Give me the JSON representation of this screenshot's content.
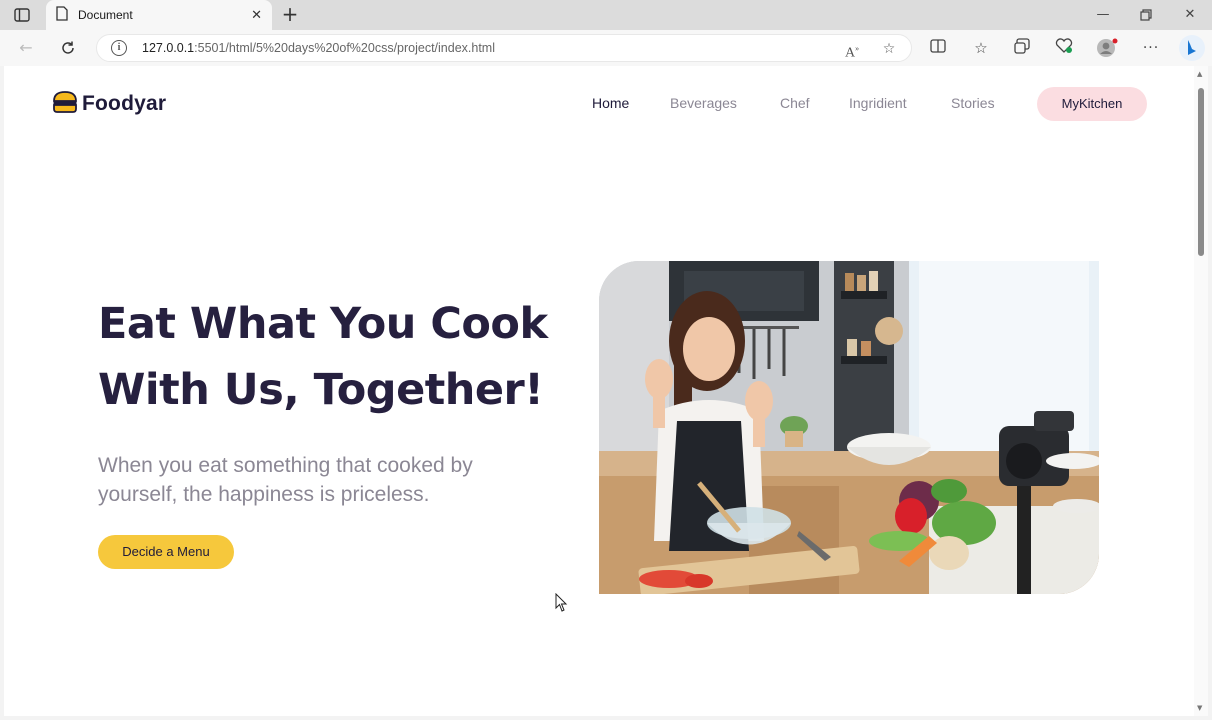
{
  "browser": {
    "tab_title": "Document",
    "url_host": "127.0.0.1",
    "url_rest": ":5501/html/5%20days%20of%20css/project/index.html",
    "icons": [
      "sidebar-icon",
      "page-icon",
      "close-icon",
      "plus-icon",
      "back-icon",
      "refresh-icon",
      "info-icon",
      "read-aloud-icon",
      "star-icon",
      "split-screen-icon",
      "favorites-icon",
      "collections-icon",
      "health-icon",
      "profile-icon",
      "more-icon",
      "bing-icon",
      "minimize-icon",
      "restore-icon",
      "window-close-icon"
    ]
  },
  "nav": {
    "logo_text": "Foodyar",
    "links": [
      "Home",
      "Beverages",
      "Chef",
      "Ingridient",
      "Stories"
    ],
    "active": "Home",
    "cta": "MyKitchen"
  },
  "hero": {
    "title_line1": "Eat What You Cook",
    "title_line2": "With Us, Together!",
    "subtitle": "When you eat something that cooked by yourself, the happiness is priceless.",
    "cta": "Decide a Menu"
  },
  "colors": {
    "primary_text": "#26203f",
    "muted_text": "#8b8794",
    "kitchen_button": "#fbdde1",
    "menu_button": "#f6c83c",
    "logo_accent": "#f6b81c"
  }
}
